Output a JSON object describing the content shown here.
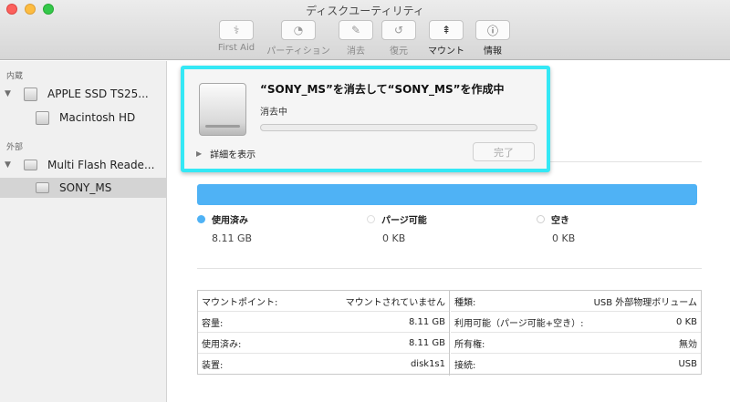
{
  "window": {
    "title": "ディスクユーティリティ"
  },
  "toolbar": [
    {
      "icon": "stethoscope-icon",
      "glyph": "⚕",
      "label": "First Aid"
    },
    {
      "icon": "pie-chart-icon",
      "glyph": "◔",
      "label": "パーティション"
    },
    {
      "icon": "erase-icon",
      "glyph": "✎",
      "label": "消去"
    },
    {
      "icon": "restore-icon",
      "glyph": "↺",
      "label": "復元"
    },
    {
      "icon": "mount-icon",
      "glyph": "⇞",
      "label": "マウント"
    },
    {
      "icon": "info-icon",
      "glyph": "ⓘ",
      "label": "情報"
    }
  ],
  "sidebar": {
    "internal_header": "内蔵",
    "internal_disk": "APPLE SSD TS25...",
    "internal_volume": "Macintosh HD",
    "external_header": "外部",
    "external_disk": "Multi Flash Reade...",
    "external_volume": "SONY_MS"
  },
  "sheet": {
    "title": "“SONY_MS”を消去して“SONY_MS”を作成中",
    "status": "消去中",
    "progress": 0,
    "details": "詳細を表示",
    "done": "完了"
  },
  "usage": {
    "used_label": "使用済み",
    "used_value": "8.11 GB",
    "used_color": "#4fb2f5",
    "purgeable_label": "パージ可能",
    "purgeable_value": "0 KB",
    "free_label": "空き",
    "free_value": "0 KB"
  },
  "info": {
    "left": [
      {
        "k": "マウントポイント:",
        "v": "マウントされていません"
      },
      {
        "k": "容量:",
        "v": "8.11 GB"
      },
      {
        "k": "使用済み:",
        "v": "8.11 GB"
      },
      {
        "k": "装置:",
        "v": "disk1s1"
      }
    ],
    "right": [
      {
        "k": "種類:",
        "v": "USB 外部物理ボリューム"
      },
      {
        "k": "利用可能（パージ可能+空き）:",
        "v": "0 KB"
      },
      {
        "k": "所有権:",
        "v": "無効"
      },
      {
        "k": "接続:",
        "v": "USB"
      }
    ]
  }
}
